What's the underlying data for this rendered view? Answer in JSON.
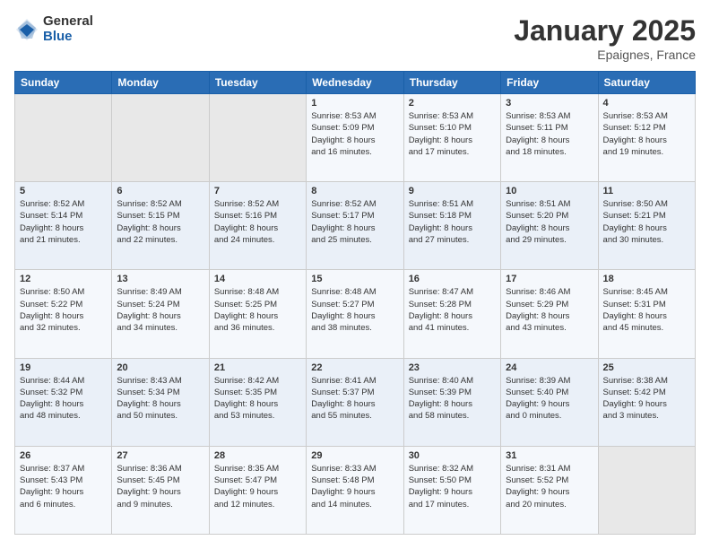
{
  "logo": {
    "general": "General",
    "blue": "Blue"
  },
  "header": {
    "month": "January 2025",
    "location": "Epaignes, France"
  },
  "weekdays": [
    "Sunday",
    "Monday",
    "Tuesday",
    "Wednesday",
    "Thursday",
    "Friday",
    "Saturday"
  ],
  "weeks": [
    [
      {
        "day": "",
        "info": ""
      },
      {
        "day": "",
        "info": ""
      },
      {
        "day": "",
        "info": ""
      },
      {
        "day": "1",
        "info": "Sunrise: 8:53 AM\nSunset: 5:09 PM\nDaylight: 8 hours\nand 16 minutes."
      },
      {
        "day": "2",
        "info": "Sunrise: 8:53 AM\nSunset: 5:10 PM\nDaylight: 8 hours\nand 17 minutes."
      },
      {
        "day": "3",
        "info": "Sunrise: 8:53 AM\nSunset: 5:11 PM\nDaylight: 8 hours\nand 18 minutes."
      },
      {
        "day": "4",
        "info": "Sunrise: 8:53 AM\nSunset: 5:12 PM\nDaylight: 8 hours\nand 19 minutes."
      }
    ],
    [
      {
        "day": "5",
        "info": "Sunrise: 8:52 AM\nSunset: 5:14 PM\nDaylight: 8 hours\nand 21 minutes."
      },
      {
        "day": "6",
        "info": "Sunrise: 8:52 AM\nSunset: 5:15 PM\nDaylight: 8 hours\nand 22 minutes."
      },
      {
        "day": "7",
        "info": "Sunrise: 8:52 AM\nSunset: 5:16 PM\nDaylight: 8 hours\nand 24 minutes."
      },
      {
        "day": "8",
        "info": "Sunrise: 8:52 AM\nSunset: 5:17 PM\nDaylight: 8 hours\nand 25 minutes."
      },
      {
        "day": "9",
        "info": "Sunrise: 8:51 AM\nSunset: 5:18 PM\nDaylight: 8 hours\nand 27 minutes."
      },
      {
        "day": "10",
        "info": "Sunrise: 8:51 AM\nSunset: 5:20 PM\nDaylight: 8 hours\nand 29 minutes."
      },
      {
        "day": "11",
        "info": "Sunrise: 8:50 AM\nSunset: 5:21 PM\nDaylight: 8 hours\nand 30 minutes."
      }
    ],
    [
      {
        "day": "12",
        "info": "Sunrise: 8:50 AM\nSunset: 5:22 PM\nDaylight: 8 hours\nand 32 minutes."
      },
      {
        "day": "13",
        "info": "Sunrise: 8:49 AM\nSunset: 5:24 PM\nDaylight: 8 hours\nand 34 minutes."
      },
      {
        "day": "14",
        "info": "Sunrise: 8:48 AM\nSunset: 5:25 PM\nDaylight: 8 hours\nand 36 minutes."
      },
      {
        "day": "15",
        "info": "Sunrise: 8:48 AM\nSunset: 5:27 PM\nDaylight: 8 hours\nand 38 minutes."
      },
      {
        "day": "16",
        "info": "Sunrise: 8:47 AM\nSunset: 5:28 PM\nDaylight: 8 hours\nand 41 minutes."
      },
      {
        "day": "17",
        "info": "Sunrise: 8:46 AM\nSunset: 5:29 PM\nDaylight: 8 hours\nand 43 minutes."
      },
      {
        "day": "18",
        "info": "Sunrise: 8:45 AM\nSunset: 5:31 PM\nDaylight: 8 hours\nand 45 minutes."
      }
    ],
    [
      {
        "day": "19",
        "info": "Sunrise: 8:44 AM\nSunset: 5:32 PM\nDaylight: 8 hours\nand 48 minutes."
      },
      {
        "day": "20",
        "info": "Sunrise: 8:43 AM\nSunset: 5:34 PM\nDaylight: 8 hours\nand 50 minutes."
      },
      {
        "day": "21",
        "info": "Sunrise: 8:42 AM\nSunset: 5:35 PM\nDaylight: 8 hours\nand 53 minutes."
      },
      {
        "day": "22",
        "info": "Sunrise: 8:41 AM\nSunset: 5:37 PM\nDaylight: 8 hours\nand 55 minutes."
      },
      {
        "day": "23",
        "info": "Sunrise: 8:40 AM\nSunset: 5:39 PM\nDaylight: 8 hours\nand 58 minutes."
      },
      {
        "day": "24",
        "info": "Sunrise: 8:39 AM\nSunset: 5:40 PM\nDaylight: 9 hours\nand 0 minutes."
      },
      {
        "day": "25",
        "info": "Sunrise: 8:38 AM\nSunset: 5:42 PM\nDaylight: 9 hours\nand 3 minutes."
      }
    ],
    [
      {
        "day": "26",
        "info": "Sunrise: 8:37 AM\nSunset: 5:43 PM\nDaylight: 9 hours\nand 6 minutes."
      },
      {
        "day": "27",
        "info": "Sunrise: 8:36 AM\nSunset: 5:45 PM\nDaylight: 9 hours\nand 9 minutes."
      },
      {
        "day": "28",
        "info": "Sunrise: 8:35 AM\nSunset: 5:47 PM\nDaylight: 9 hours\nand 12 minutes."
      },
      {
        "day": "29",
        "info": "Sunrise: 8:33 AM\nSunset: 5:48 PM\nDaylight: 9 hours\nand 14 minutes."
      },
      {
        "day": "30",
        "info": "Sunrise: 8:32 AM\nSunset: 5:50 PM\nDaylight: 9 hours\nand 17 minutes."
      },
      {
        "day": "31",
        "info": "Sunrise: 8:31 AM\nSunset: 5:52 PM\nDaylight: 9 hours\nand 20 minutes."
      },
      {
        "day": "",
        "info": ""
      }
    ]
  ]
}
